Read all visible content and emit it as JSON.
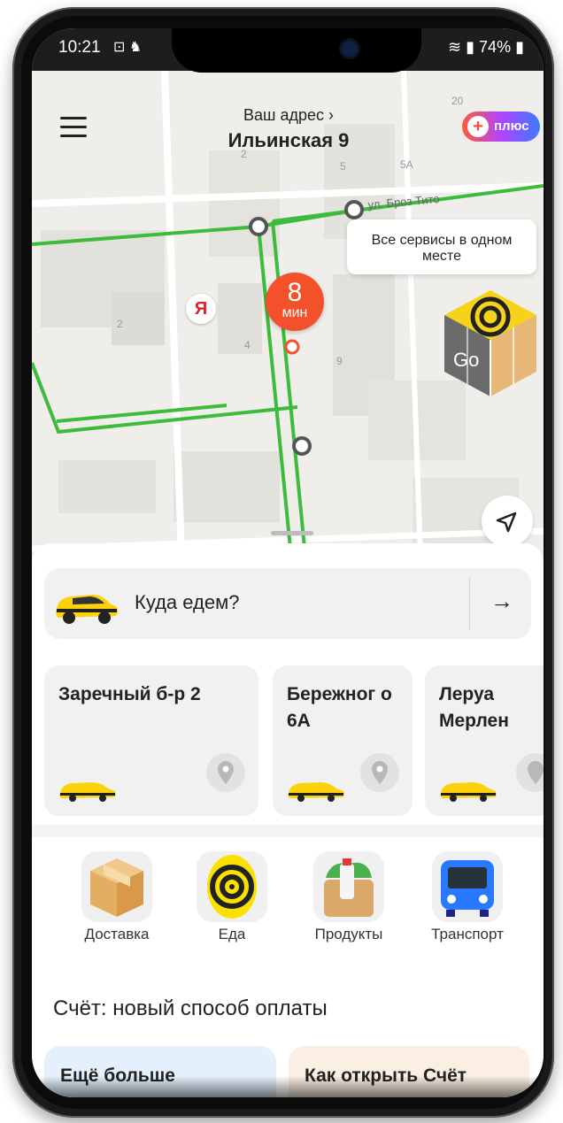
{
  "status_bar": {
    "time": "10:21",
    "left_icons": "⊡ ♞",
    "battery": "74%"
  },
  "header": {
    "address_label": "Ваш адрес",
    "address_chevron": "›",
    "address_value": "Ильинская 9",
    "plus_badge": "плюс"
  },
  "map": {
    "tooltip": "Все сервисы в одном месте",
    "street_label": "ул. Броз Тито",
    "building_numbers": [
      "2",
      "5",
      "5А",
      "20",
      "2",
      "4",
      "9"
    ],
    "eta_value": "8",
    "eta_unit": "мин",
    "yandex_marker": "Я",
    "go_label": "Go"
  },
  "where_to": {
    "placeholder": "Куда едем?",
    "arrow": "→"
  },
  "destinations": [
    {
      "title": "Заречный б-р 2"
    },
    {
      "title": "Бережног о 6А"
    },
    {
      "title": "Леруа Мерлен"
    }
  ],
  "services": [
    {
      "label": "Доставка",
      "icon": "box-icon"
    },
    {
      "label": "Еда",
      "icon": "spiral-food-icon"
    },
    {
      "label": "Продукты",
      "icon": "grocery-bag-icon"
    },
    {
      "label": "Транспорт",
      "icon": "bus-icon"
    }
  ],
  "account_section": {
    "title": "Счёт: новый способ оплаты",
    "promo_1": "Ещё больше",
    "promo_2": "Как открыть Счёт"
  },
  "colors": {
    "route_green": "#3dbb3d",
    "eta_red": "#f2512b",
    "taxi_yellow": "#fcd20c",
    "promo_blue": "#e4f0fb",
    "promo_peach": "#fbeee3"
  }
}
